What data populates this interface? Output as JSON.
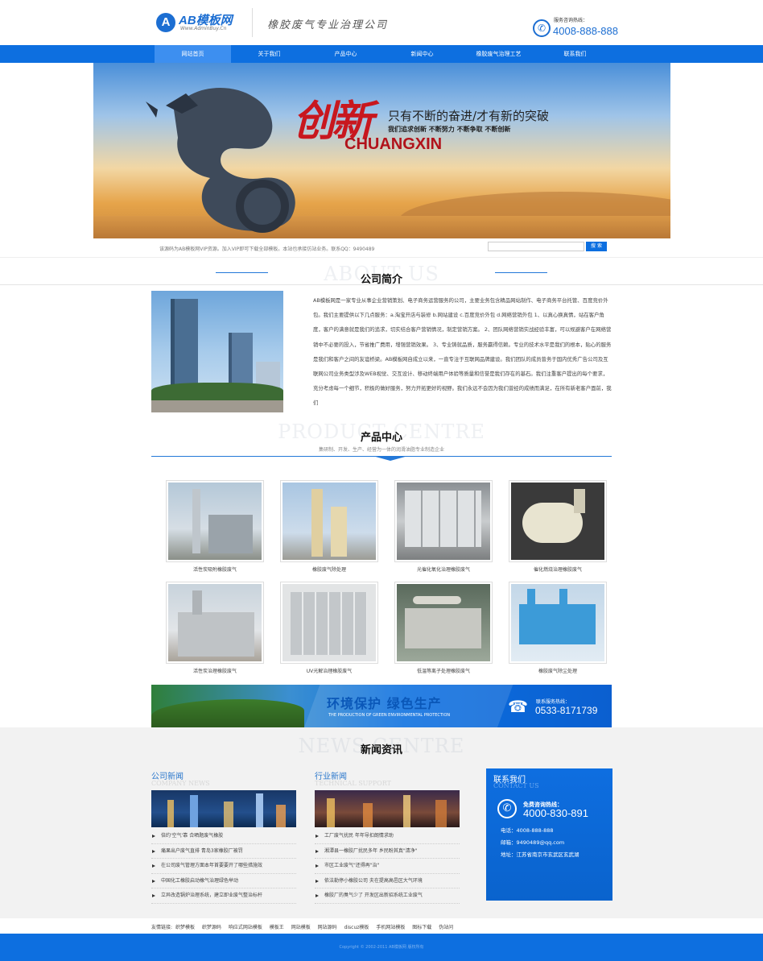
{
  "header": {
    "logo_letter": "A",
    "logo_name": "AB模板网",
    "logo_url": "Www.AdminBuy.Cn",
    "slogan": "橡胶废气专业治理公司",
    "hotline_label": "服务咨询热线：",
    "hotline_number": "4008-888-888"
  },
  "nav": {
    "items": [
      "网站首页",
      "关于我们",
      "产品中心",
      "新闻中心",
      "橡胶废气治理工艺",
      "联系我们"
    ]
  },
  "banner": {
    "headline_glyphs": "创新",
    "line1": "只有不断的奋进/才有新的突破",
    "line2": "我们追求创新  不断努力  不断争取  不断创新",
    "line3": "CHUANGXIN"
  },
  "search": {
    "tip": "该源码为AB模板网VIP资源。加入VIP即可下载全部模板。本站也承接仿站业务。联系QQ：9490489",
    "placeholder": "",
    "button": "搜 索"
  },
  "about": {
    "bg_title": "ABOUT US",
    "title": "公司简介",
    "text": "AB模板网是一家专业从事企业营销策划、电子商务运营服务的公司，主要业务包含精品网站制作、电子商务平台托管、百度竞价外包。我们主要提供以下几点服务：a.淘宝开店与装修 b.网站建设 c.百度竞价外包 d.网络营销外包 1、以真心换真情，站在客户角度，客户的满意就是我们的追求，切实结合客户营销情况，制定营销方案。 2、团队网络营销实战经验丰富，可以规避客户在网络营销中不必要的投入，节省推广费用，增强营销效果。 3、专业铸就品质，服务赢得信赖。专业的技术水平是我们的根本，贴心的服务是我们和客户之间的友谊桥梁。AB模板网自成立以来，一直专注于互联网品牌建设。我们团队的成员曾务于国内优秀广告公司及互联网公司业务类型涉及WEB视觉、交互设计、移动终端用户体验等质量和信誉是我们存在的基石。我们注重客户提出的每个要求，充分考虑每一个细节，积极的做好服务，努力开拓更好的视野。我们永远不会因为我们曾经的成绩而满足，在所有新老客户面前，我们"
  },
  "products": {
    "bg_title": "PRODUCT CENTRE",
    "title": "产品中心",
    "subtitle": "集研制、开发、生产、经营为一体的润滑油脂专业制造企业",
    "items": [
      {
        "caption": "活性炭吸附橡胶废气"
      },
      {
        "caption": "橡胶废气除处理"
      },
      {
        "caption": "光催化氧化治理橡胶废气"
      },
      {
        "caption": "催化燃烧治理橡胶废气"
      },
      {
        "caption": "活性炭治理橡胶废气"
      },
      {
        "caption": "UV光解治理橡胶废气"
      },
      {
        "caption": "低温等离子处理橡胶废气"
      },
      {
        "caption": "橡胶废气除尘处理"
      }
    ]
  },
  "eco_banner": {
    "title": "环境保护  绿色生产",
    "subtitle": "THE PRODUCTION OF GREEN ENVIRONMENTAL PROTECTION",
    "hotline_label": "联系服务热线：",
    "hotline_number": "0533-8171739"
  },
  "news": {
    "bg_title": "NEWS CENTRE",
    "title": "新闻资讯",
    "company": {
      "title": "公司新闻",
      "title_en": "COMPANY NEWS",
      "items": [
        "倍约'空气'靠 合晒题废气橡胶",
        "痛果出户废气直排 青岛3家橡胶厂被罚",
        "在公司废气管理方面本年首要要开了哪些措施效",
        "中国化工橡胶启动橡气治理绿色举动",
        "立异改造锅炉治理系统，建立即业废气整治标杆"
      ]
    },
    "industry": {
      "title": "行业新闻",
      "title_en": "TECHNICAL SUPPORT",
      "items": [
        "工厂废气扰民 年年导扣朗情求助",
        "湘潭县一橡胶厂扰民多年 乡民盼其真\"清净\"",
        "市区工业废气\"还得再\"治\"",
        "依法勒停小橡胶公司 夫在提高高邑区大气环境",
        "橡胶厂的臭气少了 开发区出新招系统工业废气"
      ]
    },
    "contact": {
      "title": "联系我们",
      "title_en": "CONTACT US",
      "free_label": "免费咨询热线：",
      "free_number": "4000-830-891",
      "phone": "电话：4008-888-888",
      "email": "邮箱：9490489@qq.com",
      "address": "地址：江苏省南京市玄武区玄武湖"
    }
  },
  "links": {
    "label": "友情链接:",
    "items": [
      "织梦模板",
      "织梦源码",
      "响应式网站模板",
      "模板王",
      "网站模板",
      "网站源码",
      "discuz模板",
      "手机网站模板",
      "图标下载",
      "伪站问"
    ]
  },
  "footer": {
    "copyright": "Copyright © 2002-2011 AB模板网 版权所有"
  }
}
